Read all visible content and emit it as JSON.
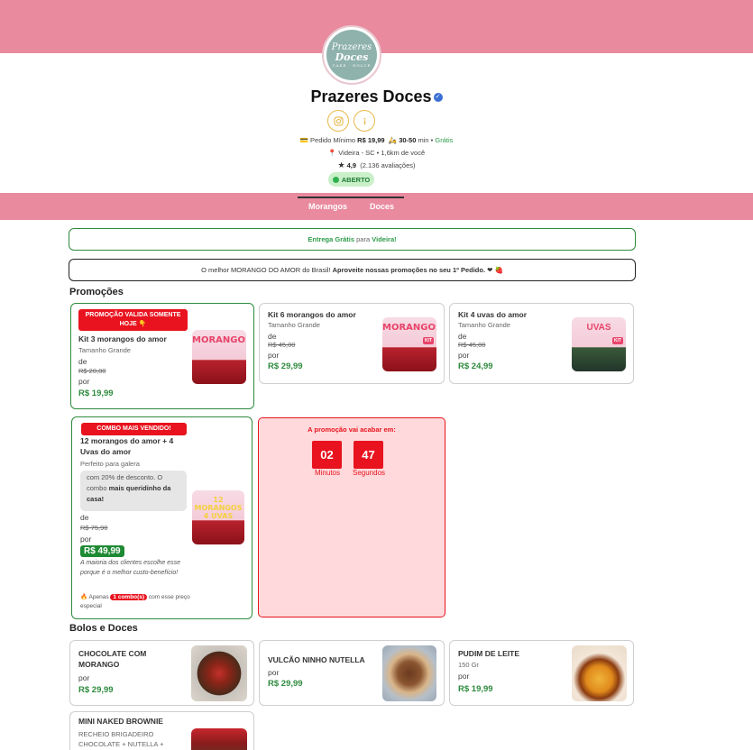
{
  "store": {
    "logo_line1": "Prazeres",
    "logo_line2": "Doces",
    "logo_line3": "CAKE · DOLCE",
    "name": "Prazeres Doces",
    "verified_symbol": "✓",
    "instagram_icon": "instagram-icon",
    "info_icon": "info-icon",
    "min_order_label": "Pedido Mínimo",
    "min_order_value": "R$ 19,99",
    "delivery_time": "30-50",
    "delivery_unit": "min",
    "delivery_fee": "Grátis",
    "location": "Videira - SC • 1,6km de você",
    "rating": "4,9",
    "reviews": "(2.136 avaliações)",
    "status": "ABERTO"
  },
  "nav": {
    "tabs": [
      {
        "label": "Morangos"
      },
      {
        "label": "Doces"
      }
    ]
  },
  "banners": {
    "delivery_part1": "Entrega Grátis",
    "delivery_part2": "para",
    "delivery_part3": "Videira!",
    "promo_text": "O melhor MORANGO DO AMOR do Brasil!",
    "promo_bold": "Aproveite nossas promoções no seu 1º Pedido.",
    "promo_emoji": "❤ 🍓"
  },
  "sections": {
    "promocoes": "Promoções",
    "bolos": "Bolos e Doces"
  },
  "promos": [
    {
      "tag": "PROMOÇÃO VALIDA SOMENTE HOJE 👇",
      "name": "Kit 3 morangos do amor",
      "desc": "Tamanho Grande",
      "de": "de",
      "old_price": "R$ 20,00",
      "por": "por",
      "price": "R$ 19,99",
      "thumb_title": "MORANGOS"
    },
    {
      "name": "Kit 6 morangos do amor",
      "desc": "Tamanho Grande",
      "de": "de",
      "old_price": "R$ 45,00",
      "por": "por",
      "price": "R$ 29,99",
      "thumb_title": "MORANGOS",
      "kit": "KIT"
    },
    {
      "name": "Kit 4 uvas do amor",
      "desc": "Tamanho Grande",
      "de": "de",
      "old_price": "R$ 45,00",
      "por": "por",
      "price": "R$ 24,99",
      "thumb_title": "UVAS",
      "kit": "KIT"
    }
  ],
  "combo": {
    "tag": "COMBO MAIS VENDIDO!",
    "name": "12 morangos do amor + 4 Uvas do amor",
    "desc": "Perfeito para galera",
    "note_part1": "com 20% de desconto. O combo",
    "note_bold": "mais queridinho da casa!",
    "de": "de",
    "old_price": "R$ 75,90",
    "por": "por",
    "price": "R$ 49,99",
    "italic": "A maioria dos clientes escolhe esse porque é o melhor custo-benefício!",
    "fire_prefix": "Apenas",
    "fire_pill": "1 combo(s)",
    "fire_suffix": "com esse preço especial",
    "thumb_title": "12 MORANGOS 4 UVAS"
  },
  "timer": {
    "title": "A promoção vai acabar em:",
    "minutes": "02",
    "seconds": "47",
    "minutes_label": "Minutos",
    "seconds_label": "Segundos"
  },
  "bolos": [
    {
      "name": "CHOCOLATE COM MORANGO",
      "por": "por",
      "price": "R$ 29,99"
    },
    {
      "name": "VULCÃO NINHO NUTELLA",
      "por": "por",
      "price": "R$ 29,99"
    },
    {
      "name": "PUDIM DE LEITE",
      "desc": "150 Gr",
      "por": "por",
      "price": "R$ 19,99"
    },
    {
      "name": "MINI NAKED BROWNIE",
      "desc": "RECHEIO BRIGADEIRO CHOCOLATE + NUTELLA +"
    }
  ],
  "colors": {
    "brand_pink": "#e98a9e",
    "green": "#2e8b3e",
    "red": "#e8131e",
    "gold": "#e8b84c"
  }
}
